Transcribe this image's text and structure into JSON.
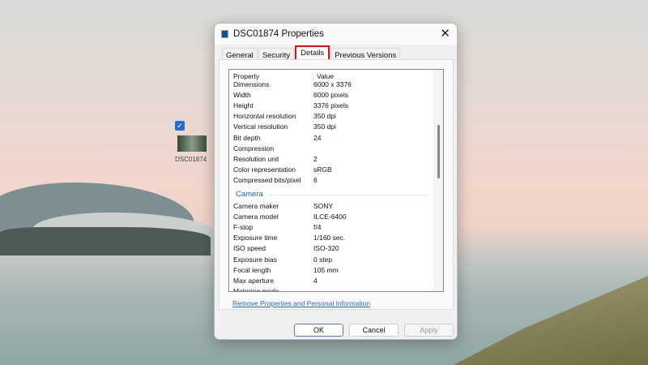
{
  "desktop": {
    "icon_label": "DSC01874"
  },
  "dialog": {
    "title": "DSC01874 Properties",
    "tabs": [
      "General",
      "Security",
      "Details",
      "Previous Versions"
    ],
    "active_tab": "Details",
    "header": {
      "property": "Property",
      "value": "Value"
    },
    "image_rows": [
      [
        "Dimensions",
        "6000 x 3376"
      ],
      [
        "Width",
        "6000 pixels"
      ],
      [
        "Height",
        "3376 pixels"
      ],
      [
        "Horizontal resolution",
        "350 dpi"
      ],
      [
        "Vertical resolution",
        "350 dpi"
      ],
      [
        "Bit depth",
        "24"
      ],
      [
        "Compression",
        ""
      ],
      [
        "Resolution unit",
        "2"
      ],
      [
        "Color representation",
        "sRGB"
      ],
      [
        "Compressed bits/pixel",
        "6"
      ]
    ],
    "camera_section": "Camera",
    "camera_rows": [
      [
        "Camera maker",
        "SONY"
      ],
      [
        "Camera model",
        "ILCE-6400"
      ],
      [
        "F-stop",
        "f/4"
      ],
      [
        "Exposure time",
        "1/160 sec."
      ],
      [
        "ISO speed",
        "ISO-320"
      ],
      [
        "Exposure bias",
        "0 step"
      ],
      [
        "Focal length",
        "105 mm"
      ],
      [
        "Max aperture",
        "4"
      ],
      [
        "Metering mode",
        ""
      ]
    ],
    "remove_link": "Remove Properties and Personal Information",
    "buttons": {
      "ok": "OK",
      "cancel": "Cancel",
      "apply": "Apply"
    },
    "highlight_color": "#e01010"
  }
}
